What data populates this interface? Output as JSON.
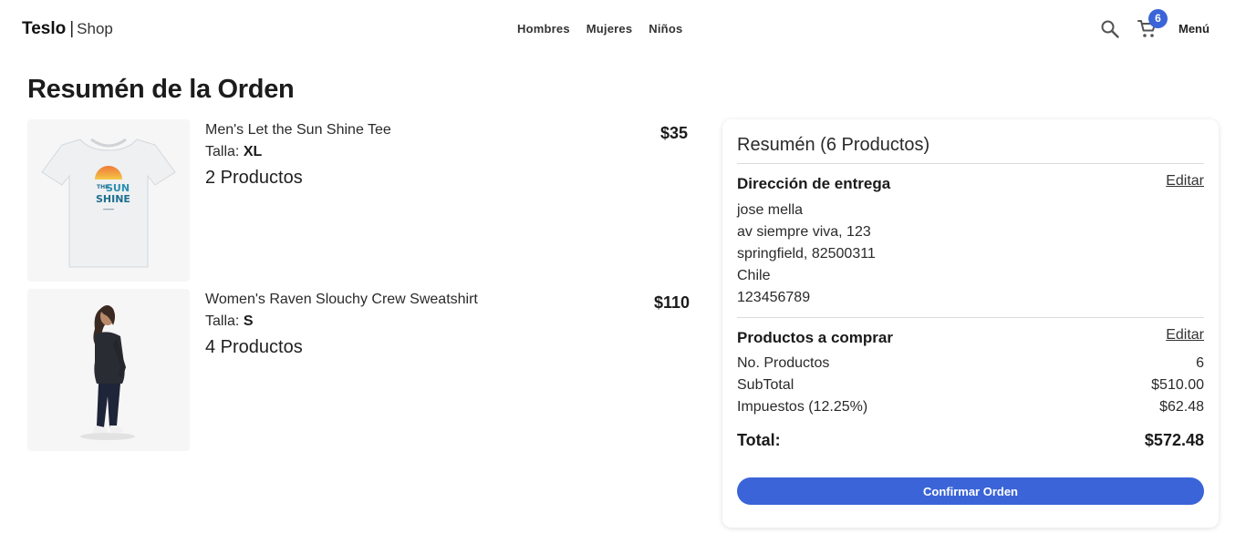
{
  "header": {
    "brand_name": "Teslo",
    "brand_separator": "|",
    "brand_sub": "Shop",
    "nav": [
      "Hombres",
      "Mujeres",
      "Niños"
    ],
    "cart_count": "6",
    "menu_label": "Menú",
    "accent_color": "#3a64d8"
  },
  "page_title": "Resumén de la Orden",
  "products": [
    {
      "name": "Men's Let the Sun Shine Tee",
      "size_label": "Talla:",
      "size": "XL",
      "quantity": "2 Productos",
      "price": "$35",
      "image_text": [
        "THE",
        "SUN",
        "SHINE"
      ]
    },
    {
      "name": "Women's Raven Slouchy Crew Sweatshirt",
      "size_label": "Talla:",
      "size": "S",
      "quantity": "4 Productos",
      "price": "$110"
    }
  ],
  "summary": {
    "title": "Resumén (6 Productos)",
    "address_heading": "Dirección de entrega",
    "edit_label": "Editar",
    "address_lines": [
      "jose mella",
      "av siempre viva, 123",
      "springfield, 82500311",
      "Chile",
      "123456789"
    ],
    "products_heading": "Productos a comprar",
    "rows": [
      {
        "label": "No. Productos",
        "value": "6"
      },
      {
        "label": "SubTotal",
        "value": "$510.00"
      },
      {
        "label": "Impuestos (12.25%)",
        "value": "$62.48"
      }
    ],
    "total_label": "Total:",
    "total_value": "$572.48",
    "confirm_label": "Confirmar Orden"
  }
}
